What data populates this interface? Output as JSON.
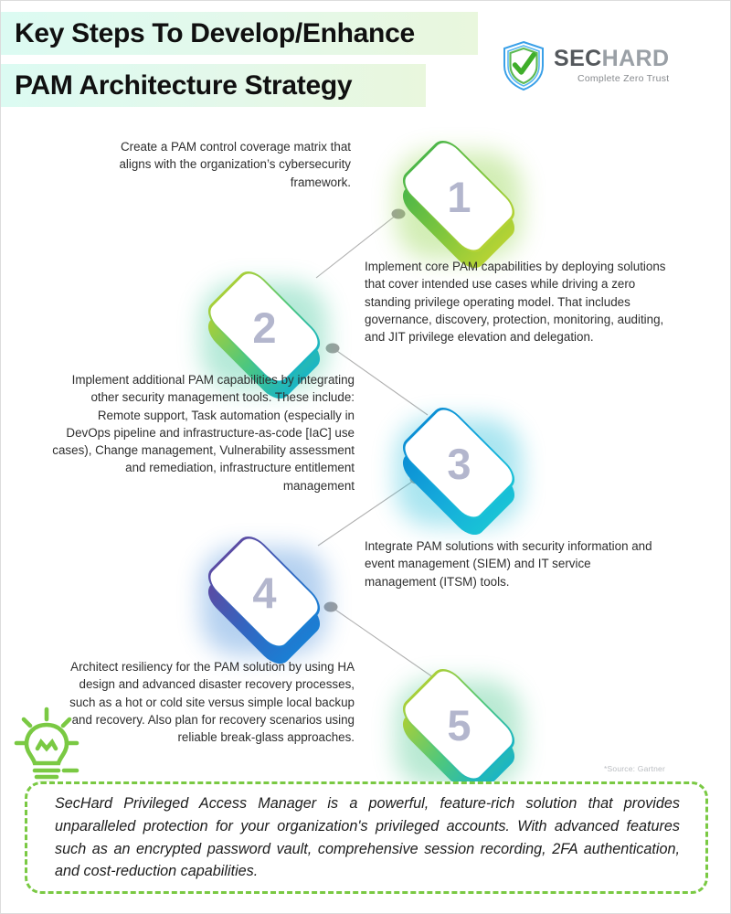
{
  "header": {
    "title_line_1": "Key Steps To Develop/Enhance",
    "title_line_2": "PAM Architecture Strategy",
    "logo": {
      "name_bold": "SEC",
      "name_light": "HARD",
      "tagline": "Complete Zero Trust"
    }
  },
  "colors": {
    "title_highlight_start": "#dcfbf2",
    "title_highlight_end": "#e9f7dd",
    "number_color": "#b3b6cd",
    "body_text": "#2e2e2e",
    "callout_border": "#7ac943",
    "bulb_green": "#7ac943",
    "connector_gray": "#b0b0b0",
    "logo_sec": "#54585c",
    "logo_hard": "#9aa0a6"
  },
  "steps": [
    {
      "number": "1",
      "text": "Create a PAM control coverage matrix that aligns with the organization’s cybersecurity framework.",
      "side": "right",
      "gradient_left": "#4cb648",
      "gradient_right": "#b5d334",
      "glow": "#8bd23f"
    },
    {
      "number": "2",
      "text": "Implement core PAM capabilities by deploying solutions that cover intended use cases while driving a zero standing privilege operating model. That includes governance, discovery, protection, monitoring, auditing, and JIT privilege elevation and delegation.",
      "side": "left",
      "gradient_left": "#a8cf38",
      "gradient_right": "#1ab5c4",
      "glow": "#3fc79a"
    },
    {
      "number": "3",
      "text": "Implement additional PAM capabilities by integrating other security management tools. These include: Remote support, Task automation (especially in DevOps pipeline and infrastructure-as-code [IaC] use cases), Change management, Vulnerability assessment and remediation, infrastructure entitlement management",
      "side": "right",
      "gradient_left": "#0b8fd4",
      "gradient_right": "#19c3d6",
      "glow": "#21bcd8"
    },
    {
      "number": "4",
      "text": "Integrate PAM solutions with security information and event management (SIEM) and IT service management (ITSM) tools.",
      "side": "left",
      "gradient_left": "#5b4ba3",
      "gradient_right": "#1a7fd4",
      "glow": "#3d87d8"
    },
    {
      "number": "5",
      "text": "Architect resiliency for the PAM solution by using HA design and advanced disaster recovery processes, such as a hot or cold site versus simple local backup and recovery. Also plan for recovery scenarios using reliable break-glass approaches.",
      "side": "right",
      "gradient_left": "#a8cf38",
      "gradient_right": "#1ab5c4",
      "glow": "#48c78c"
    }
  ],
  "source_note": "*Source: Gartner",
  "callout": {
    "text": "SecHard Privileged Access Manager is a powerful, feature-rich solution that provides unparalleled protection for your organization's privileged accounts. With advanced features such as an encrypted password vault, comprehensive session recording, 2FA authentication, and cost-reduction capabilities."
  }
}
